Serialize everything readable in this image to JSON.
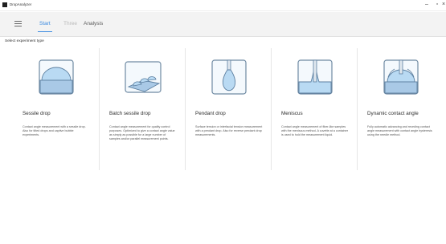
{
  "window": {
    "title": "DropAnalyzer",
    "minimize_label": "–",
    "maximize_label": "▫",
    "close_label": "×"
  },
  "nav": {
    "menu_icon": "hamburger-icon",
    "tabs": [
      {
        "label": "Start",
        "state": "active"
      },
      {
        "label": "Three",
        "state": "disabled"
      },
      {
        "label": "Analysis",
        "state": "normal"
      }
    ]
  },
  "section": {
    "label": "Select experiment type"
  },
  "cards": [
    {
      "icon": "sessile-drop-icon",
      "title": "Sessile drop",
      "description": "Contact angle measurement with a sessile drop. Also for tilted drops and captive bubble experiments."
    },
    {
      "icon": "batch-sessile-drop-icon",
      "title": "Batch sessile drop",
      "description": "Contact angle measurement for quality control purposes. Optimized to give a contact angle value as simply as possible for a large number of samples and/or parallel measurement points."
    },
    {
      "icon": "pendant-drop-icon",
      "title": "Pendant drop",
      "description": "Surface tension or interfacial tension measurement with a pendant drop. Also for reverse pendant drop measurements."
    },
    {
      "icon": "meniscus-icon",
      "title": "Meniscus",
      "description": "Contact angle measurement of fiber-like samples with the meniscus method. A cuvette at a container is used to hold the measurement liquid."
    },
    {
      "icon": "dynamic-contact-angle-icon",
      "title": "Dynamic contact angle",
      "description": "Fully automatic advancing and receding contact angle measurement with contact angle hysteresis using the needle method."
    }
  ],
  "colors": {
    "accent": "#3c8be0",
    "drop_fill": "#b9daf3",
    "icon_bg": "#e8f2fb"
  }
}
